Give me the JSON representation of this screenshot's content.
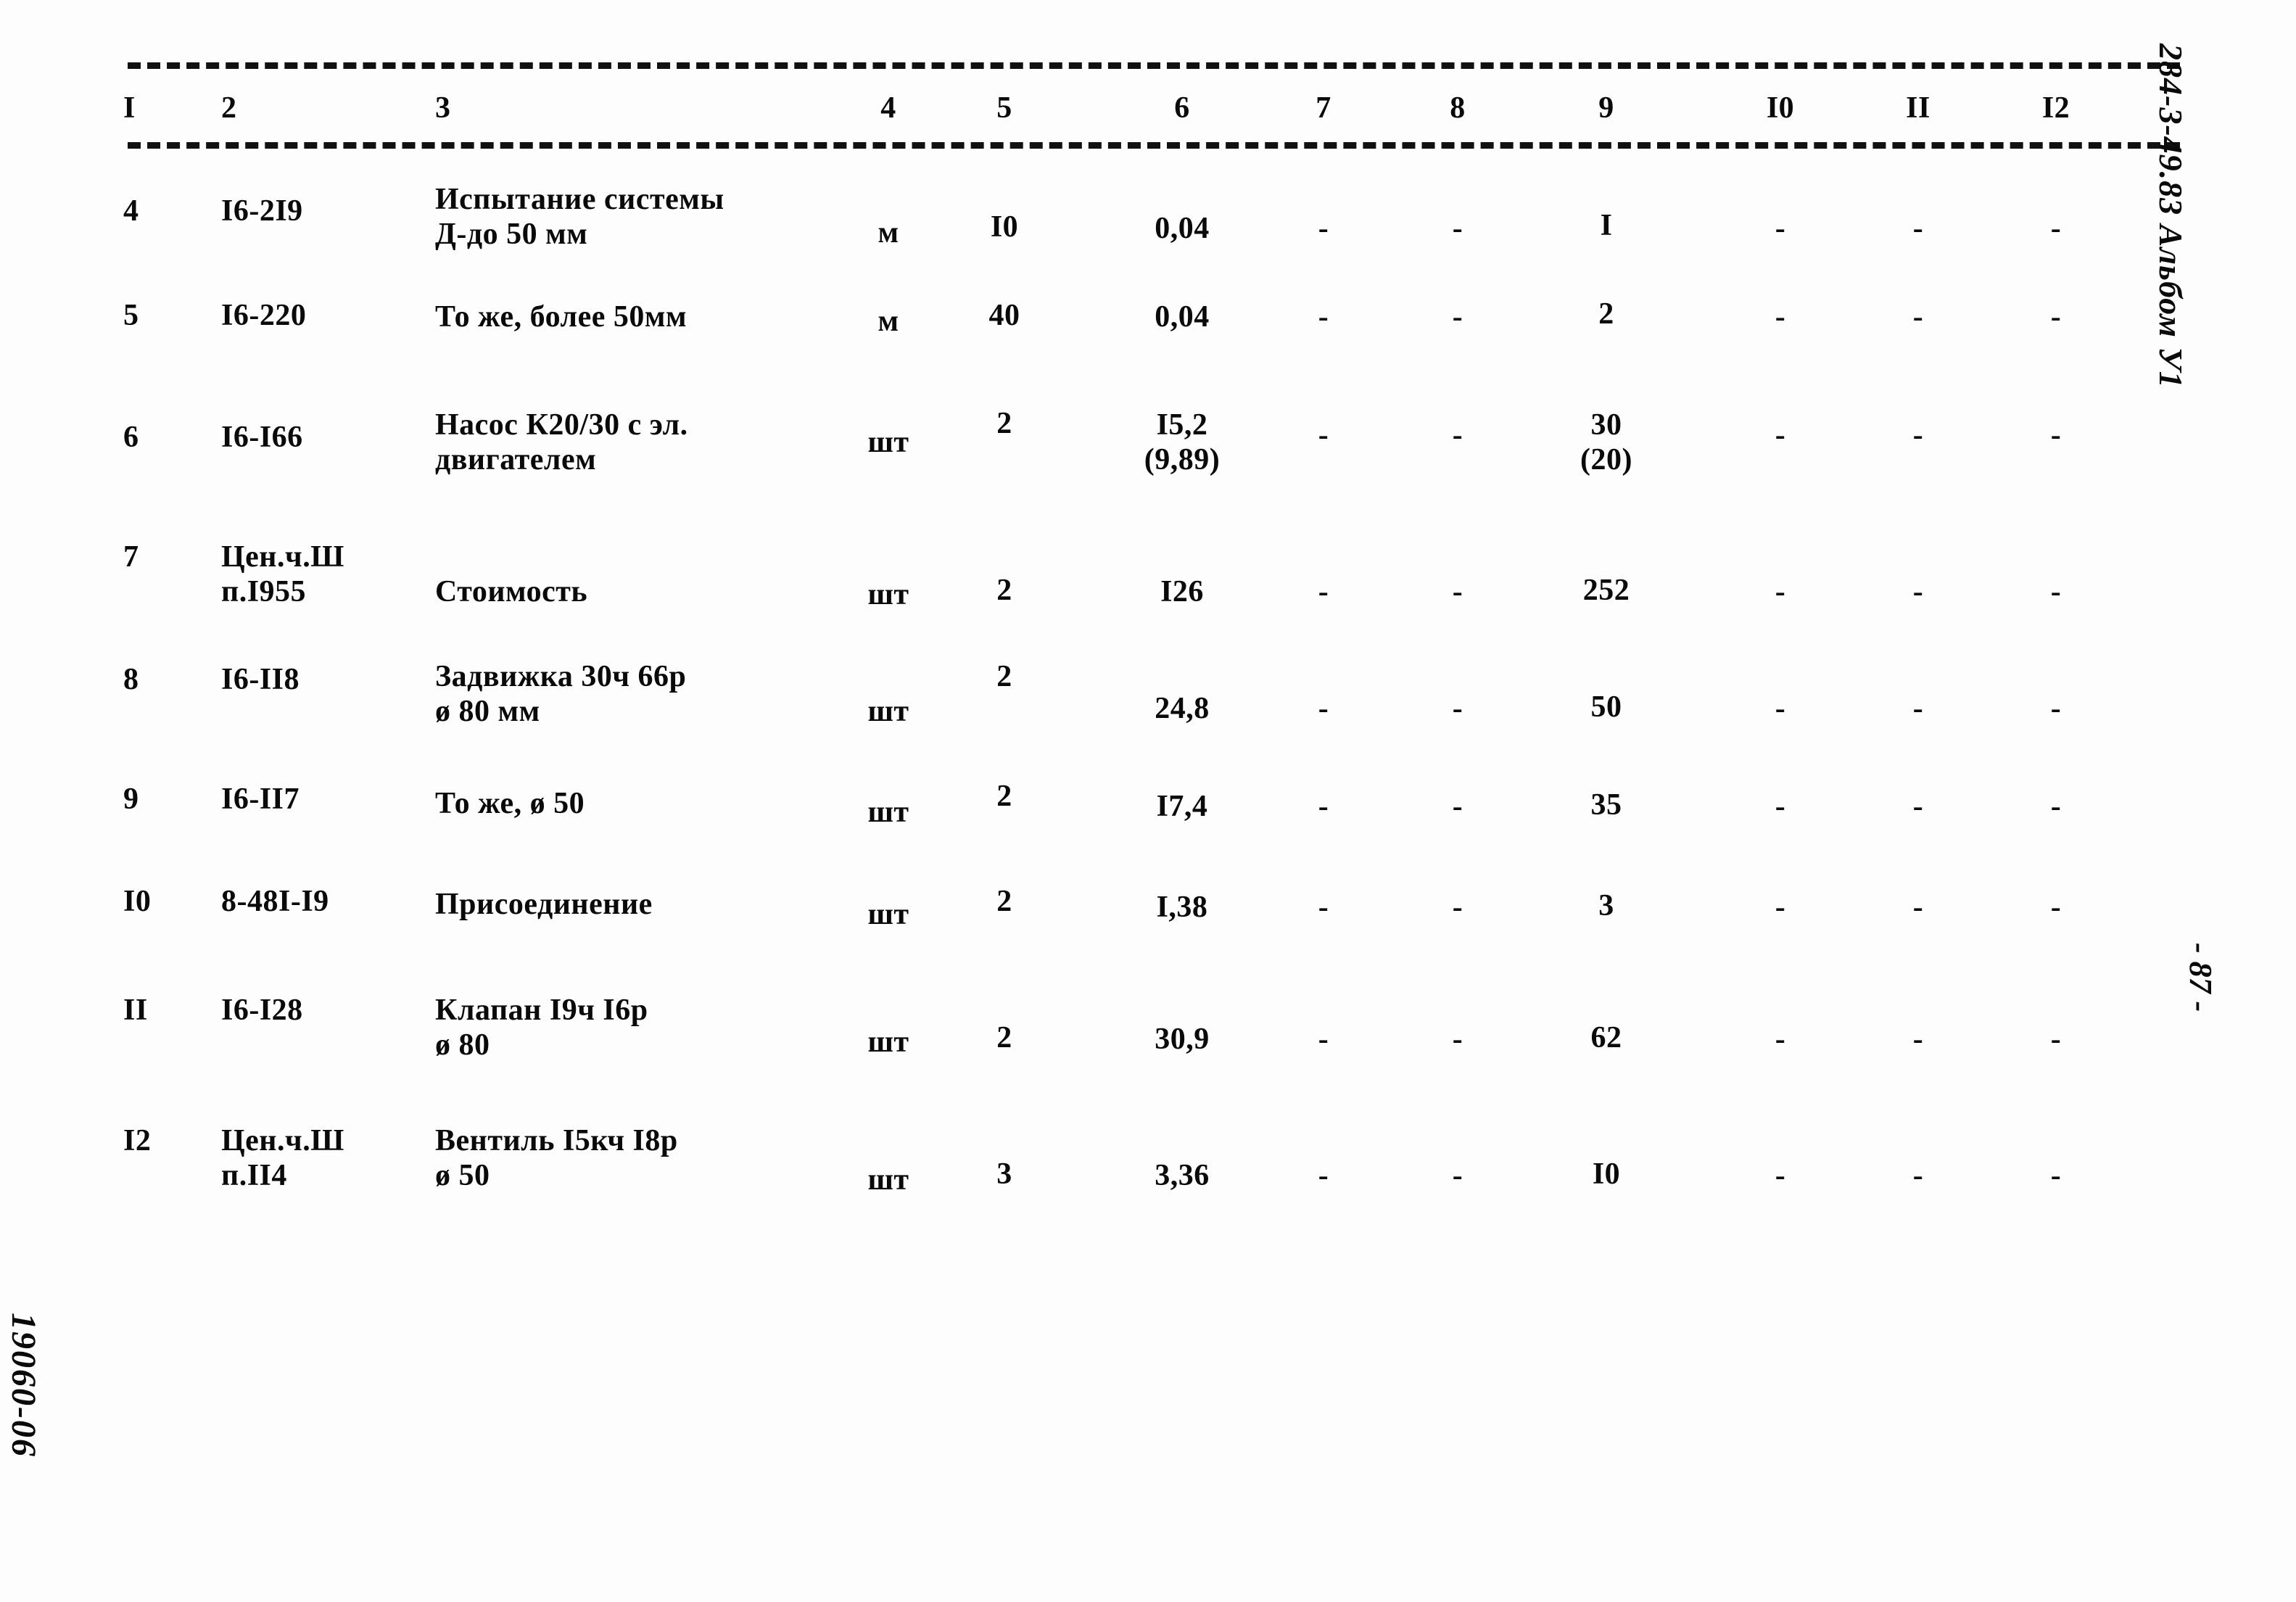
{
  "document": {
    "doc_code": "284-3-49.83 Альбом У1",
    "page_number": "- 87 -",
    "archive_code": "19060-06"
  },
  "table": {
    "column_headers": [
      "I",
      "2",
      "3",
      "4",
      "5",
      "6",
      "7",
      "8",
      "9",
      "I0",
      "II",
      "I2"
    ],
    "rows": [
      {
        "num": "4",
        "code": "I6-2I9",
        "description": "Испытание системы\nД-до 50 мм",
        "unit": "м",
        "qty": "I0",
        "col6": "0,04",
        "col7": "-",
        "col8": "-",
        "col9": "I",
        "col10": "-",
        "col11": "-",
        "col12": "-"
      },
      {
        "num": "5",
        "code": "I6-220",
        "description": "То же, более 50мм",
        "unit": "м",
        "qty": "40",
        "col6": "0,04",
        "col7": "-",
        "col8": "-",
        "col9": "2",
        "col10": "-",
        "col11": "-",
        "col12": "-"
      },
      {
        "num": "6",
        "code": "I6-I66",
        "description": "Насос К20/30 с эл.\nдвигателем",
        "unit": "шт",
        "qty": "2",
        "col6": "I5,2\n(9,89)",
        "col7": "-",
        "col8": "-",
        "col9": "30\n(20)",
        "col10": "-",
        "col11": "-",
        "col12": "-"
      },
      {
        "num": "7",
        "code": "Цен.ч.Ш\nп.I955",
        "description": "Стоимость",
        "unit": "шт",
        "qty": "2",
        "col6": "I26",
        "col7": "-",
        "col8": "-",
        "col9": "252",
        "col10": "-",
        "col11": "-",
        "col12": "-"
      },
      {
        "num": "8",
        "code": "I6-II8",
        "description": "Задвижка 30ч 66р\nø 80 мм",
        "unit": "шт",
        "qty": "2",
        "col6": "24,8",
        "col7": "-",
        "col8": "-",
        "col9": "50",
        "col10": "-",
        "col11": "-",
        "col12": "-"
      },
      {
        "num": "9",
        "code": "I6-II7",
        "description": "То же, ø 50",
        "unit": "шт",
        "qty": "2",
        "col6": "I7,4",
        "col7": "-",
        "col8": "-",
        "col9": "35",
        "col10": "-",
        "col11": "-",
        "col12": "-"
      },
      {
        "num": "I0",
        "code": "8-48I-I9",
        "description": "Присоединение",
        "unit": "шт",
        "qty": "2",
        "col6": "I,38",
        "col7": "-",
        "col8": "-",
        "col9": "3",
        "col10": "-",
        "col11": "-",
        "col12": "-"
      },
      {
        "num": "II",
        "code": "I6-I28",
        "description": "Клапан I9ч I6р\nø 80",
        "unit": "шт",
        "qty": "2",
        "col6": "30,9",
        "col7": "-",
        "col8": "-",
        "col9": "62",
        "col10": "-",
        "col11": "-",
        "col12": "-"
      },
      {
        "num": "I2",
        "code": "Цен.ч.Ш\nп.II4",
        "description": "Вентиль I5кч I8р\nø 50",
        "unit": "шт",
        "qty": "3",
        "col6": "3,36",
        "col7": "-",
        "col8": "-",
        "col9": "I0",
        "col10": "-",
        "col11": "-",
        "col12": "-"
      }
    ]
  }
}
